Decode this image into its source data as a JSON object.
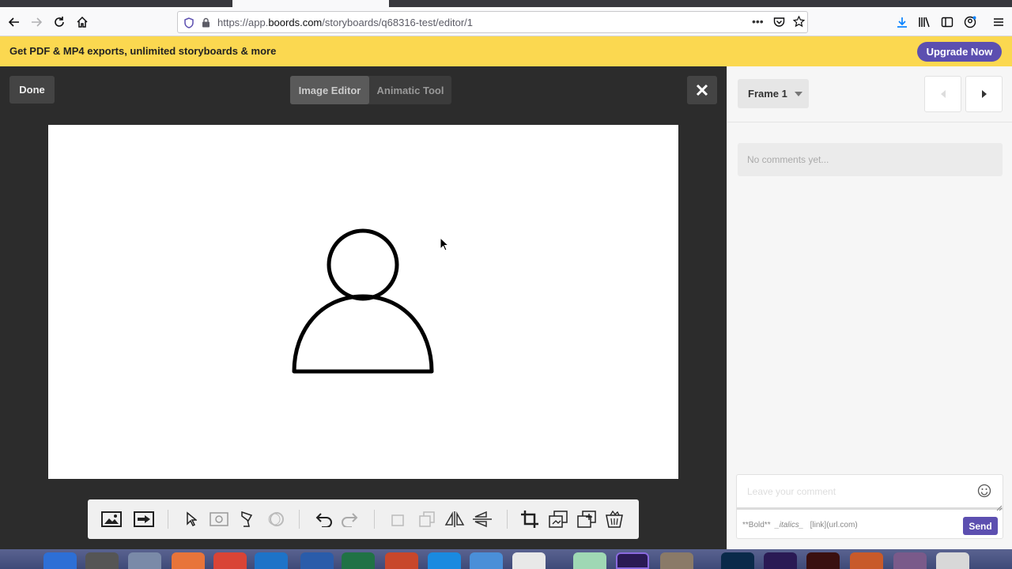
{
  "browser": {
    "url_prefix": "https://app.",
    "url_domain": "boords.com",
    "url_path": "/storyboards/q68316-test/editor/1"
  },
  "promo": {
    "text": "Get PDF & MP4 exports, unlimited storyboards & more",
    "upgrade_label": "Upgrade Now"
  },
  "editor": {
    "done_label": "Done",
    "modes": [
      "Image Editor",
      "Animatic Tool"
    ],
    "active_mode": "Image Editor"
  },
  "sidebar": {
    "frame_label": "Frame 1",
    "no_comments": "No comments yet...",
    "comment_placeholder": "Leave your comment",
    "format_bold": "**Bold**",
    "format_italic": "_italics_",
    "format_link": "[link](url.com)",
    "send_label": "Send"
  },
  "colors": {
    "promo_bg": "#fbd850",
    "accent": "#5c4fb0",
    "editor_bg": "#2c2c2c",
    "firefox_blue": "#0a84ff"
  },
  "toolbox_icons": [
    "image-icon",
    "arrow-box-icon",
    "pointer-icon",
    "camera-icon",
    "lamp-icon",
    "circle-icon",
    "undo-icon",
    "redo-icon",
    "bring-front-icon",
    "send-back-icon",
    "flip-horizontal-icon",
    "flip-vertical-icon",
    "crop-icon",
    "duplicate-icon",
    "add-layer-icon",
    "trash-icon"
  ]
}
